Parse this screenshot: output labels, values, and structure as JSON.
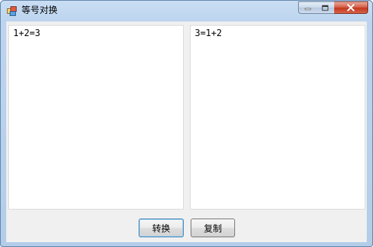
{
  "window": {
    "title": "等号对换"
  },
  "editors": {
    "left_value": "1+2=3",
    "right_value": "3=1+2"
  },
  "buttons": {
    "convert_label": "转换",
    "copy_label": "复制"
  },
  "colors": {
    "close_button": "#c2391f",
    "focus_border": "#3c7fb1",
    "client_bg": "#f0f0f0"
  }
}
